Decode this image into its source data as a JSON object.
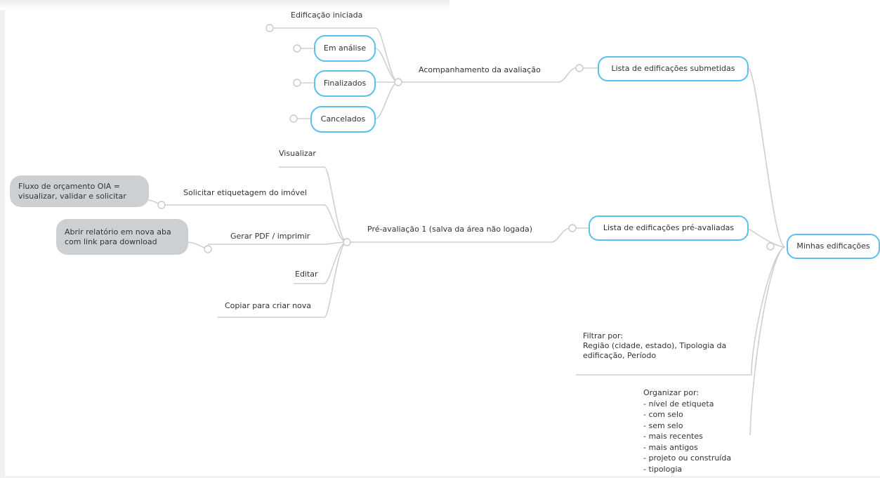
{
  "mindmap": {
    "root": "Minhas edificações",
    "branch_submetidas": {
      "label": "Lista de edificações submetidas",
      "sub": "Acompanhamento da avaliação",
      "children": [
        "Edificação iniciada",
        "Em análise",
        "Finalizados",
        "Cancelados"
      ]
    },
    "branch_preavaliadas": {
      "label": "Lista de edificações pré-avaliadas",
      "sub": "Pré-avaliação 1 (salva da área não logada)",
      "children": [
        "Visualizar",
        "Solicitar etiquetagem do imóvel",
        "Gerar PDF / imprimir",
        "Editar",
        "Copiar para criar nova"
      ],
      "notes": {
        "solicitar": "Fluxo de orçamento OIA = visualizar, validar e solicitar",
        "gerar_pdf": "Abrir relatório em nova aba com link para download"
      }
    },
    "filtrar": "Filtrar por:\nRegião (cidade, estado), Tipologia da edificação, Período",
    "organizar": "Organizar por:\n- nível de etiqueta\n- com selo\n- sem selo\n- mais recentes\n- mais antigos\n- projeto ou construída\n- tipologia"
  },
  "colors": {
    "pill_border": "#5bc0ee",
    "connector": "#cfcfcf",
    "note_fill": "#cdd0d3"
  }
}
